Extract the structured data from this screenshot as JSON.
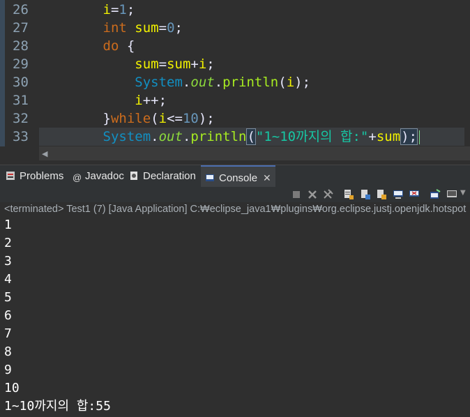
{
  "editor": {
    "line_numbers": [
      "26",
      "27",
      "28",
      "29",
      "30",
      "31",
      "32",
      "33"
    ],
    "lines": [
      {
        "indent": "        ",
        "parts": [
          [
            "var",
            "i"
          ],
          [
            "op",
            "="
          ],
          [
            "num",
            "1"
          ],
          [
            "op",
            ";"
          ]
        ]
      },
      {
        "indent": "        ",
        "parts": [
          [
            "kw",
            "int"
          ],
          [
            "op",
            " "
          ],
          [
            "var",
            "sum"
          ],
          [
            "op",
            "="
          ],
          [
            "num",
            "0"
          ],
          [
            "op",
            ";"
          ]
        ]
      },
      {
        "indent": "        ",
        "parts": [
          [
            "kw",
            "do"
          ],
          [
            "op",
            " {"
          ]
        ]
      },
      {
        "indent": "            ",
        "parts": [
          [
            "var",
            "sum"
          ],
          [
            "op",
            "="
          ],
          [
            "var",
            "sum"
          ],
          [
            "op",
            "+"
          ],
          [
            "var",
            "i"
          ],
          [
            "op",
            ";"
          ]
        ]
      },
      {
        "indent": "            ",
        "parts": [
          [
            "cls",
            "System"
          ],
          [
            "op",
            "."
          ],
          [
            "fld",
            "out"
          ],
          [
            "op",
            "."
          ],
          [
            "meth",
            "println"
          ],
          [
            "op",
            "("
          ],
          [
            "var",
            "i"
          ],
          [
            "op",
            ");"
          ]
        ]
      },
      {
        "indent": "            ",
        "parts": [
          [
            "var",
            "i"
          ],
          [
            "op",
            "++;"
          ]
        ]
      },
      {
        "indent": "        ",
        "parts": [
          [
            "op",
            "}"
          ],
          [
            "kw",
            "while"
          ],
          [
            "op",
            "("
          ],
          [
            "var",
            "i"
          ],
          [
            "op",
            "<="
          ],
          [
            "num",
            "10"
          ],
          [
            "op",
            ");"
          ]
        ]
      },
      {
        "indent": "        ",
        "parts": [
          [
            "cls",
            "System"
          ],
          [
            "op",
            "."
          ],
          [
            "fld",
            "out"
          ],
          [
            "op",
            "."
          ],
          [
            "meth",
            "println"
          ],
          [
            "op",
            "("
          ],
          [
            "str",
            "\"1~10까지의 합:\""
          ],
          [
            "op",
            "+"
          ],
          [
            "var",
            "sum"
          ],
          [
            "op",
            ");"
          ]
        ]
      }
    ]
  },
  "tabs": [
    {
      "label": "Problems",
      "icon": "problems-icon"
    },
    {
      "label": "Javadoc",
      "icon": "javadoc-icon"
    },
    {
      "label": "Declaration",
      "icon": "declaration-icon"
    },
    {
      "label": "Console",
      "icon": "console-icon",
      "active": true
    }
  ],
  "console": {
    "terminated_line": "<terminated> Test1 (7) [Java Application] C:₩eclipse_java1₩plugins₩org.eclipse.justj.openjdk.hotspot",
    "output": [
      "1",
      "2",
      "3",
      "4",
      "5",
      "6",
      "7",
      "8",
      "9",
      "10",
      "1~10까지의 합:55"
    ]
  },
  "colors": {
    "accent": "#4b6eaf",
    "keyword": "#cc6c1d",
    "variable": "#f2f200",
    "string": "#17c6a3"
  }
}
